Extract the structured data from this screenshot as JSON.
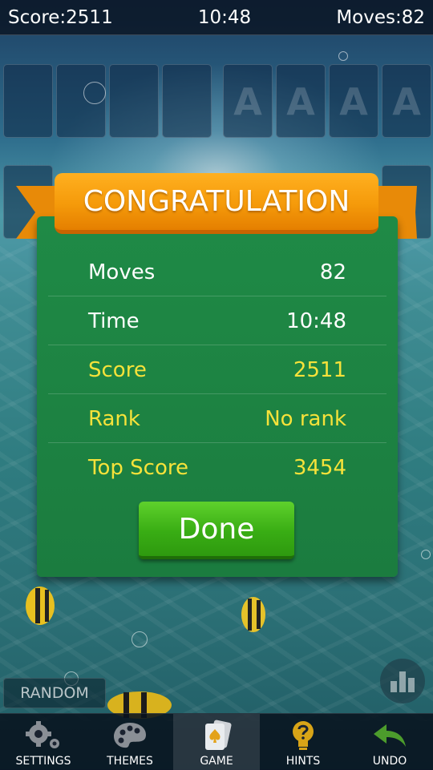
{
  "topbar": {
    "score": "Score:2511",
    "time": "10:48",
    "moves": "Moves:82"
  },
  "foundation_slots": [
    "A",
    "A",
    "A",
    "A"
  ],
  "dialog": {
    "title": "CONGRATULATION",
    "rows": [
      {
        "label": "Moves",
        "value": "82"
      },
      {
        "label": "Time",
        "value": "10:48"
      },
      {
        "label": "Score",
        "value": "2511"
      },
      {
        "label": "Rank",
        "value": "No rank"
      },
      {
        "label": "Top Score",
        "value": "3454"
      }
    ],
    "done_label": "Done"
  },
  "random_label": "RANDOM",
  "bottom_nav": [
    {
      "label": "SETTINGS",
      "icon": "gear-icon"
    },
    {
      "label": "THEMES",
      "icon": "palette-icon"
    },
    {
      "label": "GAME",
      "icon": "cards-icon",
      "active": true
    },
    {
      "label": "HINTS",
      "icon": "question-bulb-icon"
    },
    {
      "label": "UNDO",
      "icon": "undo-arrow-icon"
    }
  ],
  "colors": {
    "dialog_green": "#1f8a46",
    "ribbon_orange": "#f59a0a",
    "button_green": "#39ad14",
    "highlight_yellow": "#f6e23a"
  }
}
